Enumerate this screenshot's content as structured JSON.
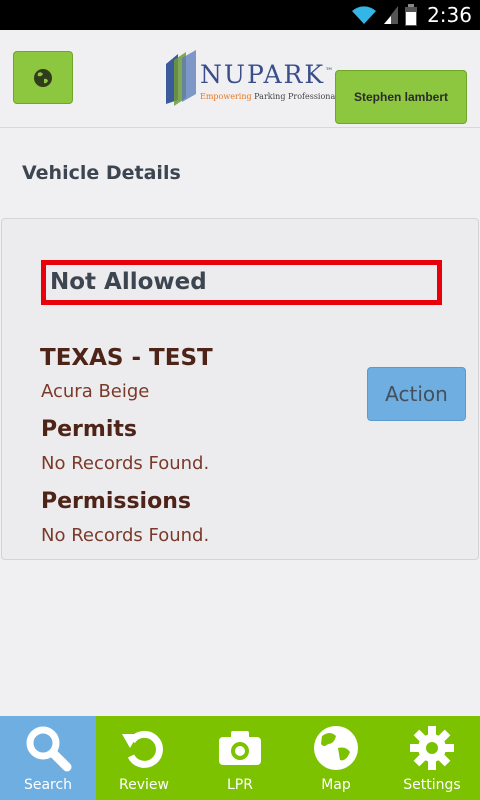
{
  "status_bar": {
    "time": "2:36",
    "icons": [
      "wifi-icon",
      "signal-icon",
      "battery-icon"
    ]
  },
  "header": {
    "logo": {
      "name": "NUPARK",
      "trademark": "™",
      "tagline_part1": "Empowering",
      "tagline_part2": " Parking Professionals"
    },
    "globe_icon": "globe-icon",
    "user_button": "Stephen lambert"
  },
  "page": {
    "title": "Vehicle Details"
  },
  "vehicle": {
    "status": "Not Allowed",
    "plate": "TEXAS - TEST",
    "description": "Acura Beige",
    "action_label": "Action",
    "permits_heading": "Permits",
    "permits_value": "No Records Found.",
    "permissions_heading": "Permissions",
    "permissions_value": "No Records Found."
  },
  "nav": {
    "items": [
      {
        "label": "Search",
        "icon": "search-icon",
        "active": true
      },
      {
        "label": "Review",
        "icon": "review-icon",
        "active": false
      },
      {
        "label": "LPR",
        "icon": "camera-icon",
        "active": false
      },
      {
        "label": "Map",
        "icon": "map-globe-icon",
        "active": false
      },
      {
        "label": "Settings",
        "icon": "gear-icon",
        "active": false
      }
    ]
  },
  "colors": {
    "accent_green": "#8dc63f",
    "nav_green": "#7cc200",
    "active_blue": "#6eaee0",
    "alert_red": "#e8000b",
    "text_brown": "#4e2318"
  }
}
